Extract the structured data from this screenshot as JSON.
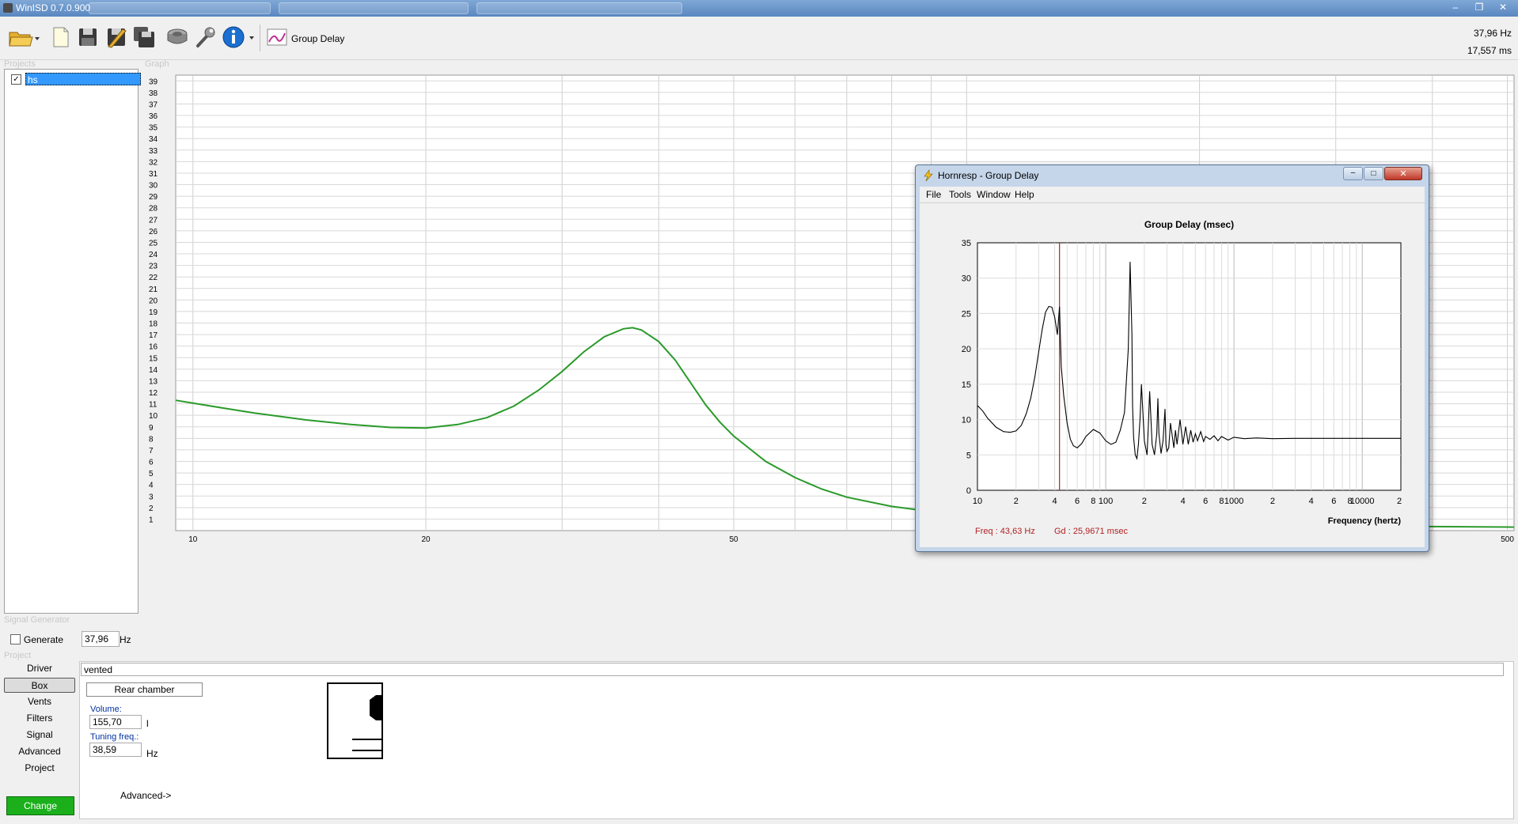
{
  "app": {
    "title": "WinISD 0.7.0.900"
  },
  "toolbar": {
    "icons": [
      "open-folder-icon",
      "new-file-icon",
      "save-icon",
      "save-as-icon",
      "save-all-icon",
      "driver-icon",
      "tools-wrench-icon",
      "info-icon"
    ],
    "group_delay_label": "Group Delay"
  },
  "readout": {
    "frequency": "37,96 Hz",
    "delay": "17,557 ms"
  },
  "projects": {
    "group_label": "Projects",
    "items": [
      {
        "label": "hs",
        "checked": true
      }
    ]
  },
  "graph": {
    "group_label": "Graph"
  },
  "signal_generator": {
    "group_label": "Signal Generator",
    "generate_label": "Generate",
    "frequency_value": "37,96",
    "unit": "Hz"
  },
  "project_panel": {
    "group_label": "Project",
    "nav": [
      "Driver",
      "Box",
      "Vents",
      "Filters",
      "Signal",
      "Advanced",
      "Project"
    ],
    "active_nav": "Box",
    "change_label": "Change",
    "box_type": "vented",
    "rear_chamber_label": "Rear chamber",
    "volume_label": "Volume:",
    "volume_value": "155,70",
    "volume_unit": "l",
    "tuning_label": "Tuning freq.:",
    "tuning_value": "38,59",
    "tuning_unit": "Hz",
    "advanced_link": "Advanced->"
  },
  "hornresp": {
    "title": "Hornresp - Group Delay",
    "menu": [
      "File",
      "Tools",
      "Window",
      "Help"
    ],
    "cursor_freq": "Freq : 43,63 Hz",
    "cursor_gd": "Gd : 25,9671 msec"
  },
  "colors": {
    "curve_green": "#2a9a2a",
    "hornresp_cursor": "#b22222",
    "change_green": "#1bb01b",
    "selection_blue": "#3399ff"
  },
  "chart_data": [
    {
      "type": "line",
      "title": "",
      "xlabel": "",
      "ylabel": "",
      "x_scale": "log",
      "xlim": [
        9.5,
        510
      ],
      "ylim": [
        0,
        39.5
      ],
      "x_ticks": [
        "10",
        "20",
        "50",
        "100",
        "200",
        "500"
      ],
      "y_ticks": [
        "1",
        "2",
        "3",
        "4",
        "5",
        "6",
        "7",
        "8",
        "9",
        "10",
        "11",
        "12",
        "13",
        "14",
        "15",
        "16",
        "17",
        "18",
        "19",
        "20",
        "21",
        "22",
        "23",
        "24",
        "25",
        "26",
        "27",
        "28",
        "29",
        "30",
        "31",
        "32",
        "33",
        "34",
        "35",
        "36",
        "37",
        "38",
        "39"
      ],
      "grid": true,
      "series": [
        {
          "x": [
            9.5,
            11,
            12,
            14,
            16,
            18,
            20,
            22,
            24,
            26,
            28,
            30,
            32,
            34,
            36,
            37,
            38,
            40,
            42,
            44,
            46,
            48,
            50,
            55,
            60,
            65,
            70,
            80,
            90,
            100,
            120,
            150,
            200,
            250,
            300,
            400,
            510
          ],
          "y": [
            11.3,
            10.6,
            10.2,
            9.6,
            9.2,
            8.95,
            8.9,
            9.2,
            9.8,
            10.8,
            12.2,
            13.8,
            15.5,
            16.8,
            17.5,
            17.6,
            17.4,
            16.4,
            14.8,
            12.8,
            10.9,
            9.4,
            8.2,
            6.0,
            4.6,
            3.6,
            2.9,
            2.1,
            1.65,
            1.35,
            1.05,
            0.8,
            0.6,
            0.5,
            0.44,
            0.35,
            0.3
          ]
        }
      ]
    },
    {
      "type": "line",
      "title": "Group Delay (msec)",
      "xlabel": "Frequency (hertz)",
      "ylabel": "",
      "x_scale": "log",
      "xlim": [
        10,
        20000
      ],
      "ylim": [
        0,
        35
      ],
      "x_ticks": [
        "10",
        "2",
        "4",
        "6",
        "8",
        "100",
        "2",
        "4",
        "6",
        "8",
        "1000",
        "2",
        "4",
        "6",
        "8",
        "10000",
        "2"
      ],
      "y_ticks": [
        "0",
        "5",
        "10",
        "15",
        "20",
        "25",
        "30",
        "35"
      ],
      "grid": true,
      "cursor_x": 43.63,
      "series": [
        {
          "x": [
            10,
            11,
            12,
            14,
            16,
            18,
            20,
            22,
            24,
            26,
            28,
            30,
            32,
            34,
            36,
            38,
            40,
            42,
            43.63,
            45,
            47,
            50,
            53,
            56,
            60,
            65,
            70,
            80,
            90,
            100,
            110,
            120,
            130,
            140,
            150,
            155,
            160,
            162,
            165,
            170,
            175,
            180,
            185,
            190,
            200,
            210,
            215,
            220,
            230,
            240,
            250,
            255,
            260,
            270,
            280,
            290,
            295,
            300,
            310,
            320,
            340,
            350,
            360,
            380,
            400,
            420,
            440,
            460,
            480,
            500,
            520,
            550,
            580,
            600,
            650,
            700,
            750,
            800,
            900,
            1000,
            1200,
            1500,
            2000,
            3000,
            5000,
            10000,
            20000
          ],
          "y": [
            12,
            11.2,
            10.2,
            8.9,
            8.3,
            8.2,
            8.4,
            9.2,
            10.8,
            13.0,
            16.0,
            19.5,
            22.8,
            25.2,
            26.0,
            25.9,
            24.5,
            22.0,
            25.97,
            17.5,
            13.5,
            9.5,
            7.2,
            6.3,
            6.0,
            6.6,
            7.6,
            8.6,
            8.1,
            7.0,
            6.5,
            6.8,
            8.5,
            11.0,
            20.0,
            32.3,
            22.0,
            12.0,
            7.5,
            5.0,
            4.5,
            6.5,
            10.0,
            15.0,
            7.0,
            5.0,
            9.0,
            14.0,
            6.5,
            5.0,
            8.0,
            13.0,
            8.0,
            5.2,
            7.0,
            11.5,
            6.5,
            5.5,
            6.0,
            9.5,
            6.0,
            8.5,
            6.5,
            10.0,
            6.5,
            9.0,
            6.5,
            8.5,
            6.8,
            8.0,
            7.0,
            8.3,
            6.9,
            7.6,
            7.2,
            7.7,
            7.0,
            7.6,
            7.1,
            7.5,
            7.3,
            7.4,
            7.3,
            7.35,
            7.35,
            7.35,
            7.35
          ]
        }
      ]
    }
  ]
}
